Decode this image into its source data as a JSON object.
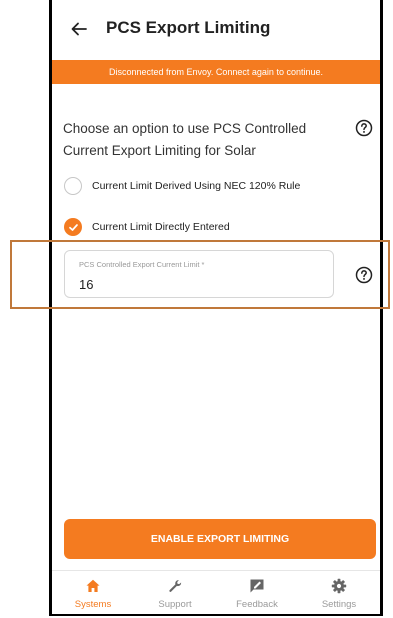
{
  "header": {
    "title": "PCS Export Limiting"
  },
  "banner": {
    "text": "Disconnected from Envoy. Connect again to continue."
  },
  "question": {
    "text": "Choose an option to use PCS Controlled Current Export Limiting for Solar"
  },
  "options": [
    {
      "label": "Current Limit Derived Using NEC 120% Rule",
      "selected": false
    },
    {
      "label": "Current Limit Directly Entered",
      "selected": true
    }
  ],
  "field": {
    "label": "PCS Controlled Export Current Limit *",
    "value": "16"
  },
  "cta": {
    "label": "ENABLE EXPORT LIMITING"
  },
  "nav": {
    "items": [
      {
        "label": "Systems",
        "icon": "home-icon",
        "active": true
      },
      {
        "label": "Support",
        "icon": "wrench-icon",
        "active": false
      },
      {
        "label": "Feedback",
        "icon": "feedback-icon",
        "active": false
      },
      {
        "label": "Settings",
        "icon": "gear-icon",
        "active": false
      }
    ]
  },
  "colors": {
    "accent": "#f47b20",
    "highlight": "#c0783a"
  }
}
